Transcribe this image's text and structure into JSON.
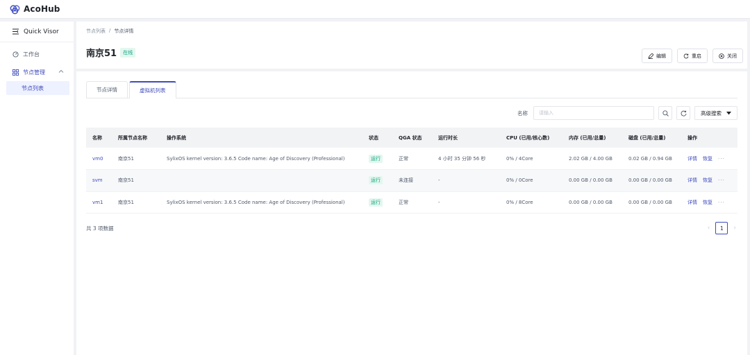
{
  "app": {
    "name": "AcoHub",
    "brand_color": "#3e4bbd"
  },
  "sidebar": {
    "quick_visor": "Quick Visor",
    "items": [
      {
        "label": "工作台",
        "icon": "dashboard-icon"
      },
      {
        "label": "节点管理",
        "icon": "grid-icon"
      }
    ],
    "sub_items": [
      {
        "label": "节点列表",
        "active": true
      }
    ]
  },
  "breadcrumb": {
    "parent": "节点列表",
    "separator": "/",
    "current": "节点详情"
  },
  "node": {
    "name": "南京51",
    "status": "在线"
  },
  "header_actions": {
    "edit": "编辑",
    "restart": "重启",
    "shutdown": "关闭"
  },
  "tabs": [
    {
      "label": "节点详情"
    },
    {
      "label": "虚拟机列表",
      "active": true
    }
  ],
  "filters": {
    "name_label": "名称",
    "name_placeholder": "请输入",
    "advanced": "高级搜索"
  },
  "table": {
    "headers": [
      "名称",
      "所属节点名称",
      "操作系统",
      "状态",
      "QGA 状态",
      "运行时长",
      "CPU (已用/核心数)",
      "内存 (已用/总量)",
      "磁盘 (已用/总量)",
      "操作"
    ],
    "rows": [
      {
        "name": "vm0",
        "node": "南京51",
        "os": "SylixOS kernel version: 3.6.5 Code name: Age of Discovery (Professional)",
        "status": "运行",
        "qga": "正常",
        "uptime": "4 小时 35 分钟 56 秒",
        "cpu": "0% / 4Core",
        "mem": "2.02 GB / 4.00 GB",
        "disk": "0.02 GB / 0.94 GB",
        "op_detail": "详情",
        "op_restore": "恢复",
        "op_more": "···"
      },
      {
        "name": "svm",
        "node": "南京51",
        "os": "",
        "status": "运行",
        "qga": "未连接",
        "uptime": "-",
        "cpu": "0% / 0Core",
        "mem": "0.00 GB / 0.00 GB",
        "disk": "0.00 GB / 0.00 GB",
        "op_detail": "详情",
        "op_restore": "恢复",
        "op_more": "···"
      },
      {
        "name": "vm1",
        "node": "南京51",
        "os": "SylixOS kernel version: 3.6.5 Code name: Age of Discovery (Professional)",
        "status": "运行",
        "qga": "正常",
        "uptime": "-",
        "cpu": "0% / 8Core",
        "mem": "0.00 GB / 0.00 GB",
        "disk": "0.00 GB / 0.00 GB",
        "op_detail": "详情",
        "op_restore": "恢复",
        "op_more": "···"
      }
    ]
  },
  "footer": {
    "total": "共 3 项数据",
    "current_page": "1",
    "prev": "‹",
    "next": "›"
  }
}
